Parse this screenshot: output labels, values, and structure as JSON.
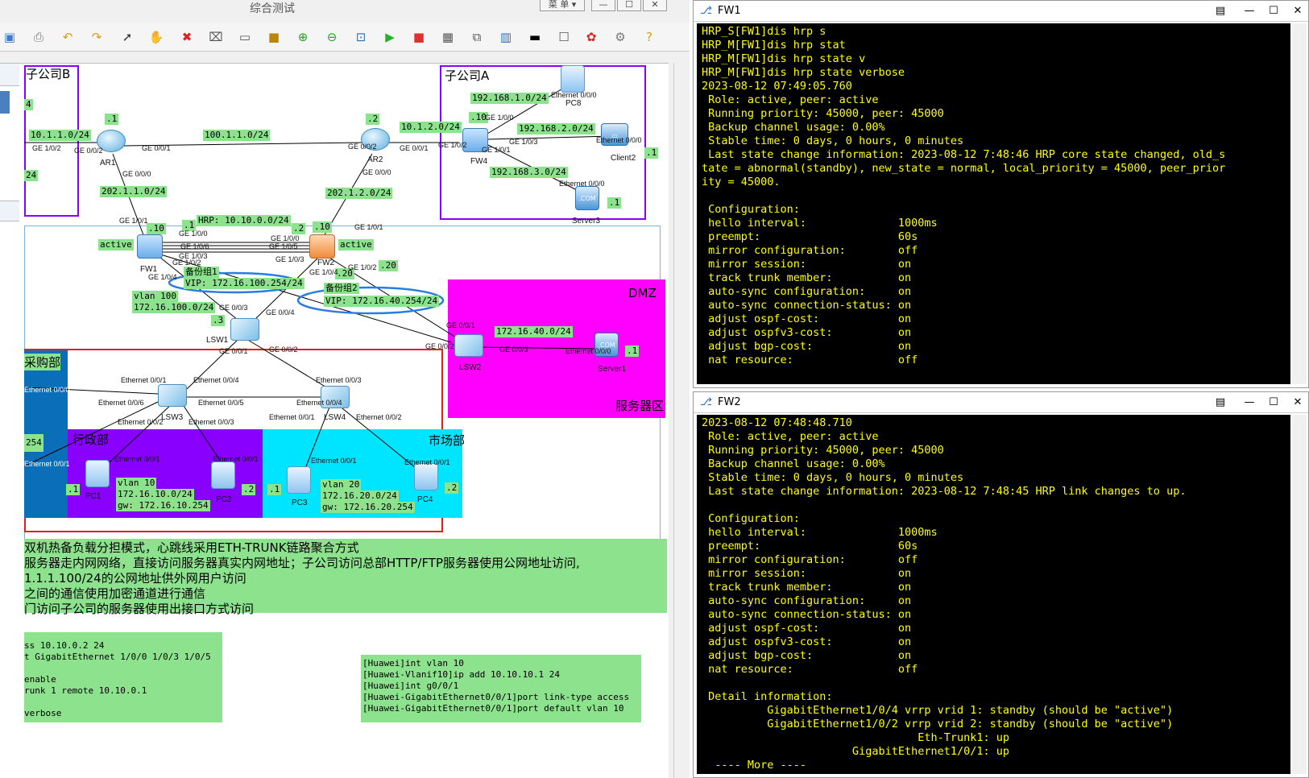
{
  "app": {
    "title": "综合测试",
    "window_buttons": [
      "菜 单 ▾",
      "—",
      "☐",
      "✕"
    ]
  },
  "toolbar_icons": [
    "save-icon",
    "print-icon",
    "undo-icon",
    "redo-icon",
    "select-icon",
    "hand-icon",
    "delete-icon",
    "clear-icon",
    "text-icon",
    "rect-icon",
    "zoom-in-icon",
    "zoom-out-icon",
    "fit-icon",
    "start-icon",
    "stop-icon",
    "capture-icon",
    "topology-icon",
    "table-icon",
    "cli-icon",
    "chat-icon",
    "huawei-icon",
    "settings-icon",
    "help-icon"
  ],
  "zones": {
    "subB": "子公司B",
    "subA": "子公司A",
    "dmz": "DMZ",
    "server_zone": "服务器区",
    "purchase": "采购部",
    "admin": "行政部",
    "market": "市场部"
  },
  "devices": {
    "AR1": "AR1",
    "AR2": "AR2",
    "FW1": "FW1",
    "FW2": "FW2",
    "FW4": "FW4",
    "LSW1": "LSW1",
    "LSW2": "LSW2",
    "LSW3": "LSW3",
    "LSW4": "LSW4",
    "PC1": "PC1",
    "PC2": "PC2",
    "PC3": "PC3",
    "PC4": "PC4",
    "PC8": "PC8",
    "Client2": "Client2",
    "Server1": "Server1",
    "Server3": "Server3"
  },
  "labels": {
    "net_10_1_1": "10.1.1.0/24",
    "net_100_1_1": "100.1.1.0/24",
    "net_10_1_2": "10.1.2.0/24",
    "net_202_1_1": "202.1.1.0/24",
    "net_202_1_2": "202.1.2.0/24",
    "net_192_1": "192.168.1.0/24",
    "net_192_2": "192.168.2.0/24",
    "net_192_3": "192.168.3.0/24",
    "hrp": "HRP: 10.10.0.0/24",
    "vip1_title": "备份组1",
    "vip1": "VIP: 172.16.100.254/24",
    "vip2_title": "备份组2",
    "vip2": "VIP: 172.16.40.254/24",
    "vlan100_a": "vlan 100",
    "vlan100_b": "172.16.100.0/24",
    "dmz_net": "172.16.40.0/24",
    "vlan10_a": "vlan 10",
    "vlan10_b": "172.16.10.0/24",
    "vlan10_c": "gw: 172.16.10.254",
    "vlan20_a": "vlan 20",
    "vlan20_b": "172.16.20.0/24",
    "vlan20_c": "gw: 172.16.20.254",
    "active1": "active",
    "active2": "active",
    "d1": ".1",
    "d2": ".2",
    "d10a": ".10",
    "d10b": ".10",
    "d2b": ".2",
    "d1b": ".1",
    "d20a": ".20",
    "d20b": ".20",
    "d3": ".3",
    "d1c": ".1",
    "d1d": ".1",
    "d1e": ".1",
    "d2c": ".2",
    "d1f": ".1",
    "d2d": ".2",
    "d1g": ".1",
    "d10c": ".10",
    "l4": "4",
    "l24": "24",
    "l254": "254"
  },
  "ports": {
    "p1": "GE 1/0/2",
    "p2": "GE 0/0/2",
    "p3": "GE 0/0/1",
    "p4": "GE 0/0/0",
    "p5": "GE 0/0/2",
    "p6": "GE 0/0/1",
    "p7": "GE 0/0/0",
    "p8": "GE 1/0/2",
    "p9": "GE 1/0/0",
    "p10": "GE 1/0/1",
    "p11": "GE 1/0/3",
    "p12": "GE 1/0/1",
    "p13": "GE 1/0/0",
    "p14": "GE 1/0/6",
    "p15": "GE 1/0/3",
    "p16": "GE 1/0/2",
    "p17": "GE 1/0/4",
    "p18": "GE 1/0/1",
    "p19": "GE 1/0/0",
    "p20": "GE 1/0/5",
    "p21": "GE 1/0/3",
    "p22": "GE 1/0/4",
    "p23": "GE 1/0/2",
    "p24": "GE 0/0/3",
    "p25": "GE 0/0/4",
    "p26": "GE 0/0/1",
    "p27": "GE 0/0/2",
    "p28": "GE 0/0/1",
    "p29": "GE 0/0/2",
    "p30": "GE 0/0/3",
    "e1": "Ethernet 0/0/1",
    "e2": "Ethernet 0/0/4",
    "e3": "Ethernet 0/0/3",
    "e4": "Ethernet 0/0/6",
    "e5": "Ethernet 0/0/5",
    "e6": "Ethernet 0/0/2",
    "e7": "Ethernet 0/0/3",
    "e8": "Ethernet 0/0/4",
    "e9": "Ethernet 0/0/1",
    "e10": "Ethernet 0/0/2",
    "e11": "Ethernet 0/0/1",
    "e12": "Ethernet 0/0/1",
    "e13": "Ethernet 0/0/1",
    "e14": "Ethernet 0/0/1",
    "e15": "Ethernet 0/0/0",
    "e16": "Ethernet 0/0/0",
    "e17": "Ethernet 0/0/0",
    "e18": "Ethernet 0/0/0",
    "e19": "Ethernet 0/0/1",
    "e20": "Ethernet 0/0/0",
    "e21": "Ethernet 0/0/1"
  },
  "notes": [
    "双机热备负载分担模式，心跳线采用ETH-TRUNK链路聚合方式",
    "服务器走内网网络，直接访问服务器真实内网地址；子公司访问总部HTTP/FTP服务器使用公网地址访问,",
    "1.1.1.100/24的公网地址供外网用户访问",
    "之间的通信使用加密通道进行通信",
    "门访问子公司的服务器使用出接口方式访问"
  ],
  "config_left": "ss 10.10.0.2 24\nt GigabitEthernet 1/0/0 1/0/3 1/0/5\n\nenable\nrunk 1 remote 10.10.0.1\n\nverbose",
  "config_right": "[Huawei]int vlan 10\n[Huawei-Vlanif10]ip add 10.10.10.1 24\n[Huawei]int g0/0/1\n[Huawei-GigabitEthernet0/0/1]port link-type access\n[Huawei-GigabitEthernet0/0/1]port default vlan 10",
  "fw1": {
    "title": "FW1",
    "lines": [
      "HRP_S[FW1]dis hrp s",
      "HRP_M[FW1]dis hrp stat",
      "HRP_M[FW1]dis hrp state v",
      "HRP_M[FW1]dis hrp state verbose",
      "2023-08-12 07:49:05.760",
      " Role: active, peer: active",
      " Running priority: 45000, peer: 45000",
      " Backup channel usage: 0.00%",
      " Stable time: 0 days, 0 hours, 0 minutes",
      " Last state change information: 2023-08-12 7:48:46 HRP core state changed, old_s",
      "tate = abnormal(standby), new_state = normal, local_priority = 45000, peer_prior",
      "ity = 45000.",
      "",
      " Configuration:",
      " hello interval:              1000ms",
      " preempt:                     60s",
      " mirror configuration:        off",
      " mirror session:              on",
      " track trunk member:          on",
      " auto-sync configuration:     on",
      " auto-sync connection-status: on",
      " adjust ospf-cost:            on",
      " adjust ospfv3-cost:          on",
      " adjust bgp-cost:             on",
      " nat resource:                off"
    ]
  },
  "fw2": {
    "title": "FW2",
    "lines": [
      "2023-08-12 07:48:48.710",
      " Role: active, peer: active",
      " Running priority: 45000, peer: 45000",
      " Backup channel usage: 0.00%",
      " Stable time: 0 days, 0 hours, 0 minutes",
      " Last state change information: 2023-08-12 7:48:45 HRP link changes to up.",
      "",
      " Configuration:",
      " hello interval:              1000ms",
      " preempt:                     60s",
      " mirror configuration:        off",
      " mirror session:              on",
      " track trunk member:          on",
      " auto-sync configuration:     on",
      " auto-sync connection-status: on",
      " adjust ospf-cost:            on",
      " adjust ospfv3-cost:          on",
      " adjust bgp-cost:             on",
      " nat resource:                off",
      "",
      " Detail information:",
      "          GigabitEthernet1/0/4 vrrp vrid 1: standby (should be \"active\")",
      "          GigabitEthernet1/0/2 vrrp vrid 2: standby (should be \"active\")",
      "                                 Eth-Trunk1: up",
      "                       GigabitEthernet1/0/1: up",
      "  ---- More ----"
    ]
  },
  "term_buttons": [
    "▤",
    "—",
    "☐",
    "✕"
  ],
  "colors": {
    "terminal_text": "#ffff00",
    "label_bg": "#8de28d",
    "dmz": "#ff00ff",
    "admin": "#8a00ff",
    "market": "#00e5ff",
    "purchase": "#0a6fb8"
  }
}
